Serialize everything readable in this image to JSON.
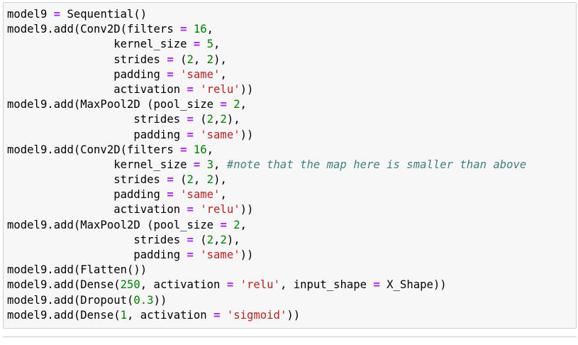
{
  "code_cell": {
    "lines": [
      [
        {
          "t": "model9 ",
          "k": "plain"
        },
        {
          "t": "=",
          "k": "op"
        },
        {
          "t": " Sequential()",
          "k": "plain"
        }
      ],
      [
        {
          "t": "model9.add(Conv2D(filters ",
          "k": "plain"
        },
        {
          "t": "=",
          "k": "op"
        },
        {
          "t": " ",
          "k": "plain"
        },
        {
          "t": "16",
          "k": "num"
        },
        {
          "t": ",",
          "k": "plain"
        }
      ],
      [
        {
          "t": "                kernel_size ",
          "k": "plain"
        },
        {
          "t": "=",
          "k": "op"
        },
        {
          "t": " ",
          "k": "plain"
        },
        {
          "t": "5",
          "k": "num"
        },
        {
          "t": ",",
          "k": "plain"
        }
      ],
      [
        {
          "t": "                strides ",
          "k": "plain"
        },
        {
          "t": "=",
          "k": "op"
        },
        {
          "t": " (",
          "k": "plain"
        },
        {
          "t": "2",
          "k": "num"
        },
        {
          "t": ", ",
          "k": "plain"
        },
        {
          "t": "2",
          "k": "num"
        },
        {
          "t": "),",
          "k": "plain"
        }
      ],
      [
        {
          "t": "                padding ",
          "k": "plain"
        },
        {
          "t": "=",
          "k": "op"
        },
        {
          "t": " ",
          "k": "plain"
        },
        {
          "t": "'same'",
          "k": "str"
        },
        {
          "t": ",",
          "k": "plain"
        }
      ],
      [
        {
          "t": "                activation ",
          "k": "plain"
        },
        {
          "t": "=",
          "k": "op"
        },
        {
          "t": " ",
          "k": "plain"
        },
        {
          "t": "'relu'",
          "k": "str"
        },
        {
          "t": "))",
          "k": "plain"
        }
      ],
      [
        {
          "t": "model9.add(MaxPool2D (pool_size ",
          "k": "plain"
        },
        {
          "t": "=",
          "k": "op"
        },
        {
          "t": " ",
          "k": "plain"
        },
        {
          "t": "2",
          "k": "num"
        },
        {
          "t": ",",
          "k": "plain"
        }
      ],
      [
        {
          "t": "                   strides ",
          "k": "plain"
        },
        {
          "t": "=",
          "k": "op"
        },
        {
          "t": " (",
          "k": "plain"
        },
        {
          "t": "2",
          "k": "num"
        },
        {
          "t": ",",
          "k": "plain"
        },
        {
          "t": "2",
          "k": "num"
        },
        {
          "t": "),",
          "k": "plain"
        }
      ],
      [
        {
          "t": "                   padding ",
          "k": "plain"
        },
        {
          "t": "=",
          "k": "op"
        },
        {
          "t": " ",
          "k": "plain"
        },
        {
          "t": "'same'",
          "k": "str"
        },
        {
          "t": "))",
          "k": "plain"
        }
      ],
      [
        {
          "t": "model9.add(Conv2D(filters ",
          "k": "plain"
        },
        {
          "t": "=",
          "k": "op"
        },
        {
          "t": " ",
          "k": "plain"
        },
        {
          "t": "16",
          "k": "num"
        },
        {
          "t": ",",
          "k": "plain"
        }
      ],
      [
        {
          "t": "                kernel_size ",
          "k": "plain"
        },
        {
          "t": "=",
          "k": "op"
        },
        {
          "t": " ",
          "k": "plain"
        },
        {
          "t": "3",
          "k": "num"
        },
        {
          "t": ", ",
          "k": "plain"
        },
        {
          "t": "#note that the map here is smaller than above",
          "k": "cmt"
        }
      ],
      [
        {
          "t": "                strides ",
          "k": "plain"
        },
        {
          "t": "=",
          "k": "op"
        },
        {
          "t": " (",
          "k": "plain"
        },
        {
          "t": "2",
          "k": "num"
        },
        {
          "t": ", ",
          "k": "plain"
        },
        {
          "t": "2",
          "k": "num"
        },
        {
          "t": "),",
          "k": "plain"
        }
      ],
      [
        {
          "t": "                padding ",
          "k": "plain"
        },
        {
          "t": "=",
          "k": "op"
        },
        {
          "t": " ",
          "k": "plain"
        },
        {
          "t": "'same'",
          "k": "str"
        },
        {
          "t": ",",
          "k": "plain"
        }
      ],
      [
        {
          "t": "                activation ",
          "k": "plain"
        },
        {
          "t": "=",
          "k": "op"
        },
        {
          "t": " ",
          "k": "plain"
        },
        {
          "t": "'relu'",
          "k": "str"
        },
        {
          "t": "))",
          "k": "plain"
        }
      ],
      [
        {
          "t": "model9.add(MaxPool2D (pool_size ",
          "k": "plain"
        },
        {
          "t": "=",
          "k": "op"
        },
        {
          "t": " ",
          "k": "plain"
        },
        {
          "t": "2",
          "k": "num"
        },
        {
          "t": ",",
          "k": "plain"
        }
      ],
      [
        {
          "t": "                   strides ",
          "k": "plain"
        },
        {
          "t": "=",
          "k": "op"
        },
        {
          "t": " (",
          "k": "plain"
        },
        {
          "t": "2",
          "k": "num"
        },
        {
          "t": ",",
          "k": "plain"
        },
        {
          "t": "2",
          "k": "num"
        },
        {
          "t": "),",
          "k": "plain"
        }
      ],
      [
        {
          "t": "                   padding ",
          "k": "plain"
        },
        {
          "t": "=",
          "k": "op"
        },
        {
          "t": " ",
          "k": "plain"
        },
        {
          "t": "'same'",
          "k": "str"
        },
        {
          "t": "))",
          "k": "plain"
        }
      ],
      [
        {
          "t": "model9.add(Flatten())",
          "k": "plain"
        }
      ],
      [
        {
          "t": "model9.add(Dense(",
          "k": "plain"
        },
        {
          "t": "250",
          "k": "num"
        },
        {
          "t": ", activation ",
          "k": "plain"
        },
        {
          "t": "=",
          "k": "op"
        },
        {
          "t": " ",
          "k": "plain"
        },
        {
          "t": "'relu'",
          "k": "str"
        },
        {
          "t": ", input_shape ",
          "k": "plain"
        },
        {
          "t": "=",
          "k": "op"
        },
        {
          "t": " X_Shape))",
          "k": "plain"
        }
      ],
      [
        {
          "t": "model9.add(Dropout(",
          "k": "plain"
        },
        {
          "t": "0.3",
          "k": "num"
        },
        {
          "t": "))",
          "k": "plain"
        }
      ],
      [
        {
          "t": "model9.add(Dense(",
          "k": "plain"
        },
        {
          "t": "1",
          "k": "num"
        },
        {
          "t": ", activation ",
          "k": "plain"
        },
        {
          "t": "=",
          "k": "op"
        },
        {
          "t": " ",
          "k": "plain"
        },
        {
          "t": "'sigmoid'",
          "k": "str"
        },
        {
          "t": "))",
          "k": "plain"
        }
      ]
    ]
  },
  "colors": {
    "cell_background": "#f7f7f7",
    "cell_border": "#cfcfcf",
    "operator": "#aa22ff",
    "number": "#008000",
    "string": "#ba2121",
    "comment": "#408080"
  }
}
